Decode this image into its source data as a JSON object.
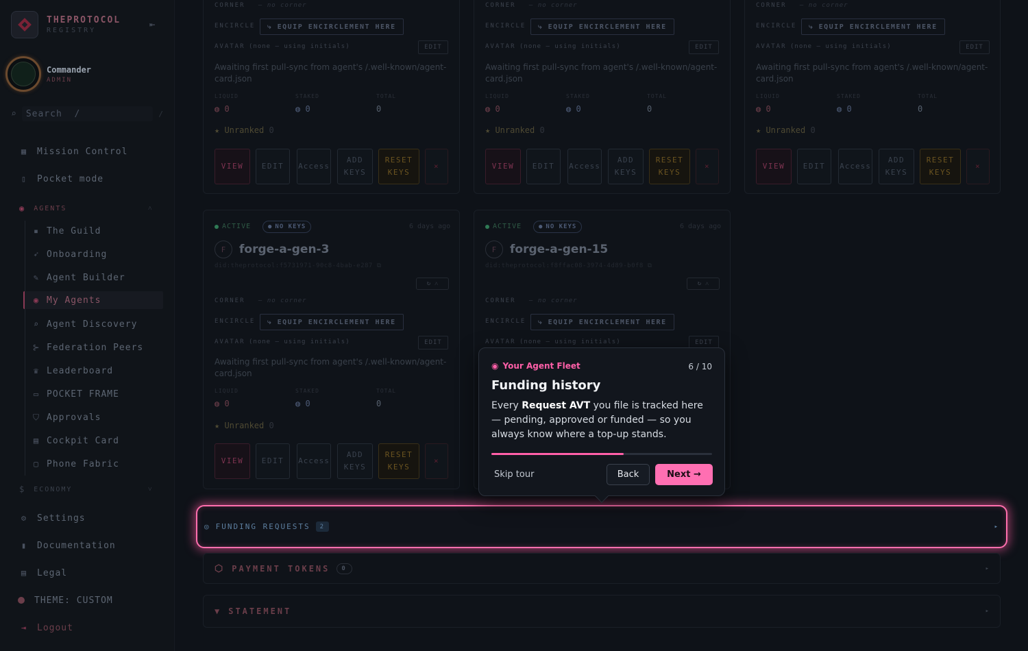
{
  "brand": {
    "name": "THEPROTOCOL",
    "sub": "REGISTRY"
  },
  "user": {
    "name": "Commander",
    "role": "ADMIN"
  },
  "search": {
    "placeholder": "Search",
    "shortcut": "/"
  },
  "nav": {
    "mission_control": "Mission Control",
    "pocket_mode": "Pocket mode",
    "agents_section": "AGENTS",
    "agents_items": [
      "The Guild",
      "Onboarding",
      "Agent Builder",
      "My Agents",
      "Agent Discovery",
      "Federation Peers",
      "Leaderboard",
      "POCKET FRAME",
      "Approvals",
      "Cockpit Card",
      "Phone Fabric"
    ],
    "economy_section": "ECONOMY",
    "settings": "Settings",
    "documentation": "Documentation",
    "legal": "Legal",
    "theme": "THEME: CUSTOM",
    "logout": "Logout"
  },
  "card_common": {
    "corner_label": "CORNER",
    "no_corner": "— no corner",
    "encircle_label": "ENCIRCLE",
    "encircle_button": "⤷ EQUIP ENCIRCLEMENT HERE",
    "avatar_label": "AVATAR",
    "avatar_value": "(none — using initials)",
    "edit": "EDIT",
    "sync_text": "Awaiting first pull-sync from agent's /.well-known/agent-card.json",
    "liquid": "LIQUID",
    "staked": "STAKED",
    "total": "TOTAL",
    "liquid_value": "0",
    "staked_value": "0",
    "total_value": "0",
    "rank": "Unranked",
    "rank_value": "0",
    "btn_view": "VIEW",
    "btn_edit": "EDIT",
    "btn_access": "Access",
    "btn_add_keys": "ADD KEYS",
    "btn_reset_keys": "RESET KEYS",
    "btn_delete": "×",
    "status_active": "ACTIVE",
    "status_nokeys": "NO KEYS"
  },
  "agents": [
    {
      "initial": "F",
      "name": "forge-a-gen-3",
      "did": "did:theprotocol:f5731971-90c8-4bab-e287",
      "ago": "6 days ago"
    },
    {
      "initial": "F",
      "name": "forge-a-gen-15",
      "did": "did:theprotocol:f8ffac08-3974-4d89-b0f8",
      "ago": "6 days ago"
    }
  ],
  "panels": {
    "funding_requests": "FUNDING REQUESTS",
    "funding_count": "2",
    "payment_tokens": "PAYMENT TOKENS",
    "payment_count": "0",
    "statement": "STATEMENT"
  },
  "tour": {
    "category": "Your Agent Fleet",
    "step": "6 / 10",
    "title": "Funding history",
    "body_prefix": "Every ",
    "body_bold": "Request AVT",
    "body_suffix": " you file is tracked here — pending, approved or funded — so you always know where a top-up stands.",
    "progress": 0.6,
    "skip": "Skip tour",
    "back": "Back",
    "next": "Next →"
  },
  "colors": {
    "accent": "#ff5fa8",
    "highlight": "#ff6fae"
  }
}
